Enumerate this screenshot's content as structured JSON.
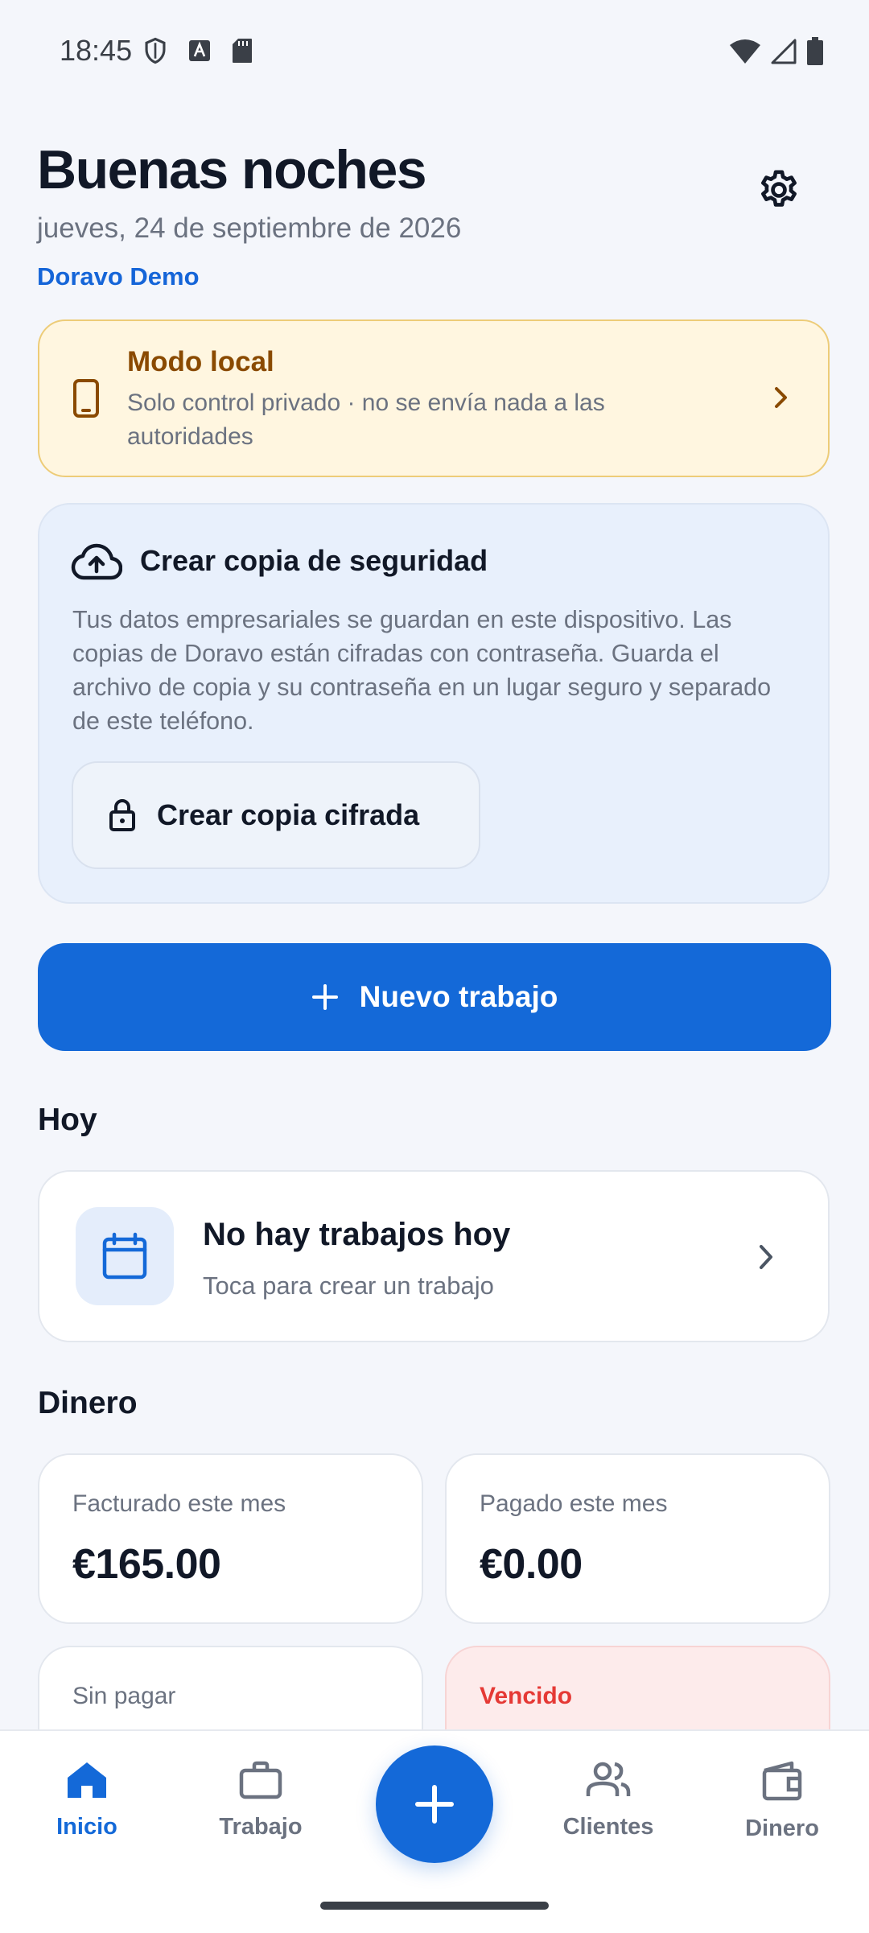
{
  "status_bar": {
    "time": "18:45"
  },
  "header": {
    "greeting": "Buenas noches",
    "date": "jueves, 24 de septiembre de 2026",
    "company": "Doravo Demo"
  },
  "local_mode": {
    "title": "Modo local",
    "subtitle": "Solo control privado · no se envía nada a las autoridades"
  },
  "backup": {
    "title": "Crear copia de seguridad",
    "text": "Tus datos empresariales se guardan en este dispositivo. Las copias de Doravo están cifradas con contraseña. Guarda el archivo de copia y su contraseña en un lugar seguro y separado de este teléfono.",
    "button_label": "Crear copia cifrada"
  },
  "new_job": {
    "label": "Nuevo trabajo"
  },
  "today": {
    "heading": "Hoy",
    "title": "No hay trabajos hoy",
    "subtitle": "Toca para crear un trabajo"
  },
  "money": {
    "heading": "Dinero",
    "invoiced_label": "Facturado este mes",
    "invoiced_value": "€165.00",
    "paid_label": "Pagado este mes",
    "paid_value": "€0.00",
    "unpaid_label": "Sin pagar",
    "overdue_label": "Vencido"
  },
  "nav": {
    "home": "Inicio",
    "work": "Trabajo",
    "clients": "Clientes",
    "money": "Dinero"
  },
  "colors": {
    "accent": "#1469D8",
    "warning_bg": "#FFF6E0",
    "warning_text": "#8A4A00",
    "overdue_bg": "#FDEBEB",
    "overdue_text": "#E53935"
  }
}
